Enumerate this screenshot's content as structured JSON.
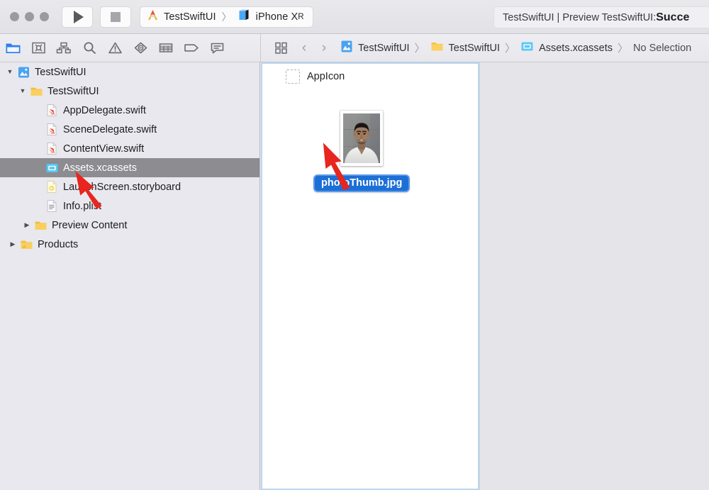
{
  "window": {
    "traffic_lights": [
      "close",
      "minimize",
      "zoom"
    ],
    "run_button": "run",
    "stop_button": "stop",
    "scheme_name": "TestSwiftUI",
    "scheme_separator": "〉",
    "destination_name": "iPhone X",
    "destination_suffix": "R",
    "status_prefix": "TestSwiftUI | Preview TestSwiftUI: ",
    "status_bold": "Succe"
  },
  "navigator_toolbar": {
    "icons": [
      {
        "name": "project-navigator-icon",
        "label": "Project navigator",
        "selected": true
      },
      {
        "name": "source-control-navigator-icon",
        "label": "Source control navigator",
        "selected": false
      },
      {
        "name": "symbol-navigator-icon",
        "label": "Symbol navigator",
        "selected": false
      },
      {
        "name": "find-navigator-icon",
        "label": "Find navigator",
        "selected": false
      },
      {
        "name": "issue-navigator-icon",
        "label": "Issue navigator",
        "selected": false
      },
      {
        "name": "test-navigator-icon",
        "label": "Test navigator",
        "selected": false
      },
      {
        "name": "debug-navigator-icon",
        "label": "Debug navigator",
        "selected": false
      },
      {
        "name": "breakpoint-navigator-icon",
        "label": "Breakpoint navigator",
        "selected": false
      },
      {
        "name": "report-navigator-icon",
        "label": "Report navigator",
        "selected": false
      }
    ]
  },
  "breadcrumb": {
    "grid_icon": "assistant-editor-icon",
    "back_arrow": "‹",
    "forward_arrow": "›",
    "separator": "〉",
    "items": [
      {
        "label": "TestSwiftUI",
        "icon": "xcode-project-icon"
      },
      {
        "label": "TestSwiftUI",
        "icon": "folder-icon"
      },
      {
        "label": "Assets.xcassets",
        "icon": "assets-catalog-icon"
      }
    ],
    "selection": "No Selection"
  },
  "sidebar": {
    "items": [
      {
        "label": "TestSwiftUI",
        "icon": "xcode-project-icon",
        "indent": 0,
        "twisty": "down",
        "selected": false
      },
      {
        "label": "TestSwiftUI",
        "icon": "folder-icon",
        "indent": 1,
        "twisty": "down",
        "selected": false
      },
      {
        "label": "AppDelegate.swift",
        "icon": "swift-file-icon",
        "indent": 2,
        "twisty": "none",
        "selected": false
      },
      {
        "label": "SceneDelegate.swift",
        "icon": "swift-file-icon",
        "indent": 2,
        "twisty": "none",
        "selected": false
      },
      {
        "label": "ContentView.swift",
        "icon": "swift-file-icon",
        "indent": 2,
        "twisty": "none",
        "selected": false
      },
      {
        "label": "Assets.xcassets",
        "icon": "assets-catalog-icon",
        "indent": 2,
        "twisty": "none",
        "selected": true
      },
      {
        "label": "LaunchScreen.storyboard",
        "icon": "storyboard-file-icon",
        "indent": 2,
        "twisty": "none",
        "selected": false
      },
      {
        "label": "Info.plist",
        "icon": "plist-file-icon",
        "indent": 2,
        "twisty": "none",
        "selected": false
      },
      {
        "label": "Preview Content",
        "icon": "folder-icon",
        "indent": 1,
        "twisty": "right",
        "selected": false
      },
      {
        "label": "Products",
        "icon": "folder-icon",
        "indent": 0,
        "twisty": "right",
        "selected": false
      }
    ]
  },
  "asset_catalog": {
    "appicon_label": "AppIcon",
    "appicon_placeholder": "empty-appicon-slot",
    "selected_asset": {
      "label": "photoThumb.jpg",
      "thumbnail": "portrait-photo-thumbnail",
      "selected": true
    }
  },
  "annotations": [
    {
      "name": "arrow-to-assets-xcassets",
      "color": "#e8251f",
      "points_to": "Assets.xcassets"
    },
    {
      "name": "arrow-to-photo-thumbnail",
      "color": "#e8251f",
      "points_to": "photoThumb.jpg"
    }
  ],
  "colors": {
    "accent_blue": "#1c6fd6",
    "selection_gray": "#8c8c91",
    "sidebar_bg": "#e8e8ee",
    "panel_focus_border": "#bcd6f0",
    "annotation_red": "#e8251f"
  }
}
